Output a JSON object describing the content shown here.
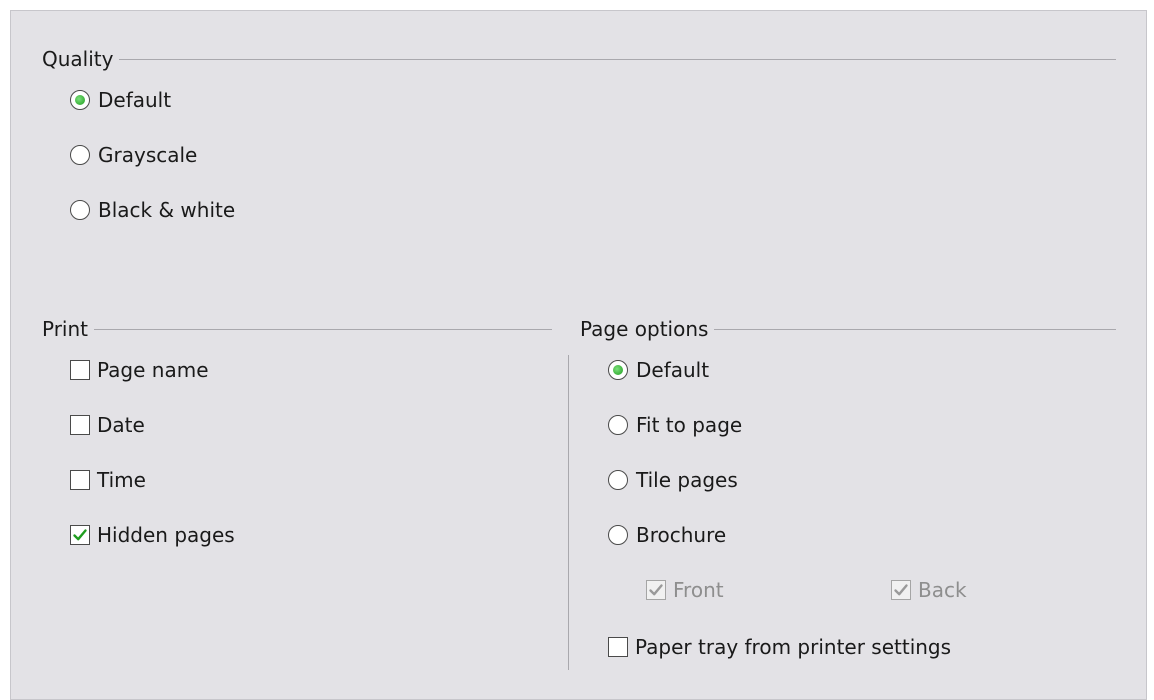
{
  "quality": {
    "title": "Quality",
    "options": [
      {
        "label": "Default",
        "selected": true
      },
      {
        "label": "Grayscale",
        "selected": false
      },
      {
        "label": "Black & white",
        "selected": false
      }
    ]
  },
  "print": {
    "title": "Print",
    "options": [
      {
        "label": "Page name",
        "checked": false
      },
      {
        "label": "Date",
        "checked": false
      },
      {
        "label": "Time",
        "checked": false
      },
      {
        "label": "Hidden pages",
        "checked": true
      }
    ]
  },
  "page_options": {
    "title": "Page options",
    "options": [
      {
        "label": "Default",
        "selected": true
      },
      {
        "label": "Fit to page",
        "selected": false
      },
      {
        "label": "Tile pages",
        "selected": false
      },
      {
        "label": "Brochure",
        "selected": false
      }
    ],
    "brochure_front": {
      "label": "Front",
      "checked": true,
      "enabled": false
    },
    "brochure_back": {
      "label": "Back",
      "checked": true,
      "enabled": false
    },
    "paper_tray": {
      "label": "Paper tray from printer settings",
      "checked": false
    }
  },
  "colors": {
    "panel_bg": "#e3e2e6",
    "radio_selected": "#1f9d1f",
    "check_mark": "#1f9d1f",
    "disabled_text": "#8e8e8e"
  }
}
